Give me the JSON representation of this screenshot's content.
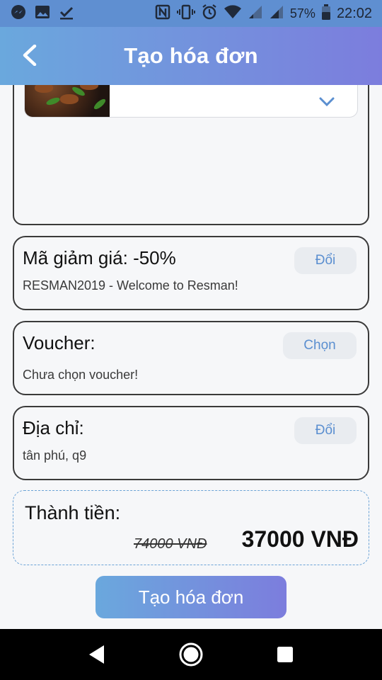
{
  "status_bar": {
    "battery_percent": "57%",
    "time": "22:02",
    "left_icons": [
      "messenger-icon",
      "gallery-icon",
      "download-check-icon"
    ],
    "right_icons": [
      "nfc-icon",
      "vibrate-icon",
      "alarm-icon",
      "wifi-icon",
      "signal-icon",
      "signal-icon",
      "battery-icon"
    ]
  },
  "header": {
    "back_icon": "back-arrow-icon",
    "title": "Tạo hóa đơn"
  },
  "colors": {
    "gradient_start": "#6aa8dd",
    "gradient_end": "#7c7ddd",
    "button_text": "#5b8fd0",
    "dashed_border": "#6ba3d6"
  },
  "discount": {
    "title": "Mã giảm giá: -50%",
    "detail": "RESMAN2019 - Welcome to Resman!",
    "button": "Đổi"
  },
  "voucher": {
    "title": "Voucher:",
    "detail": "Chưa chọn voucher!",
    "button": "Chọn"
  },
  "address": {
    "title": "Địa chỉ:",
    "detail": "tân phú, q9",
    "button": "Đổi"
  },
  "total": {
    "label": "Thành tiền:",
    "original_price": "74000 VNĐ",
    "final_price": "37000 VNĐ"
  },
  "actions": {
    "create_invoice": "Tạo hóa đơn"
  },
  "nav_bar": {
    "icons": [
      "back-triangle-icon",
      "home-circle-icon",
      "recents-square-icon"
    ]
  }
}
